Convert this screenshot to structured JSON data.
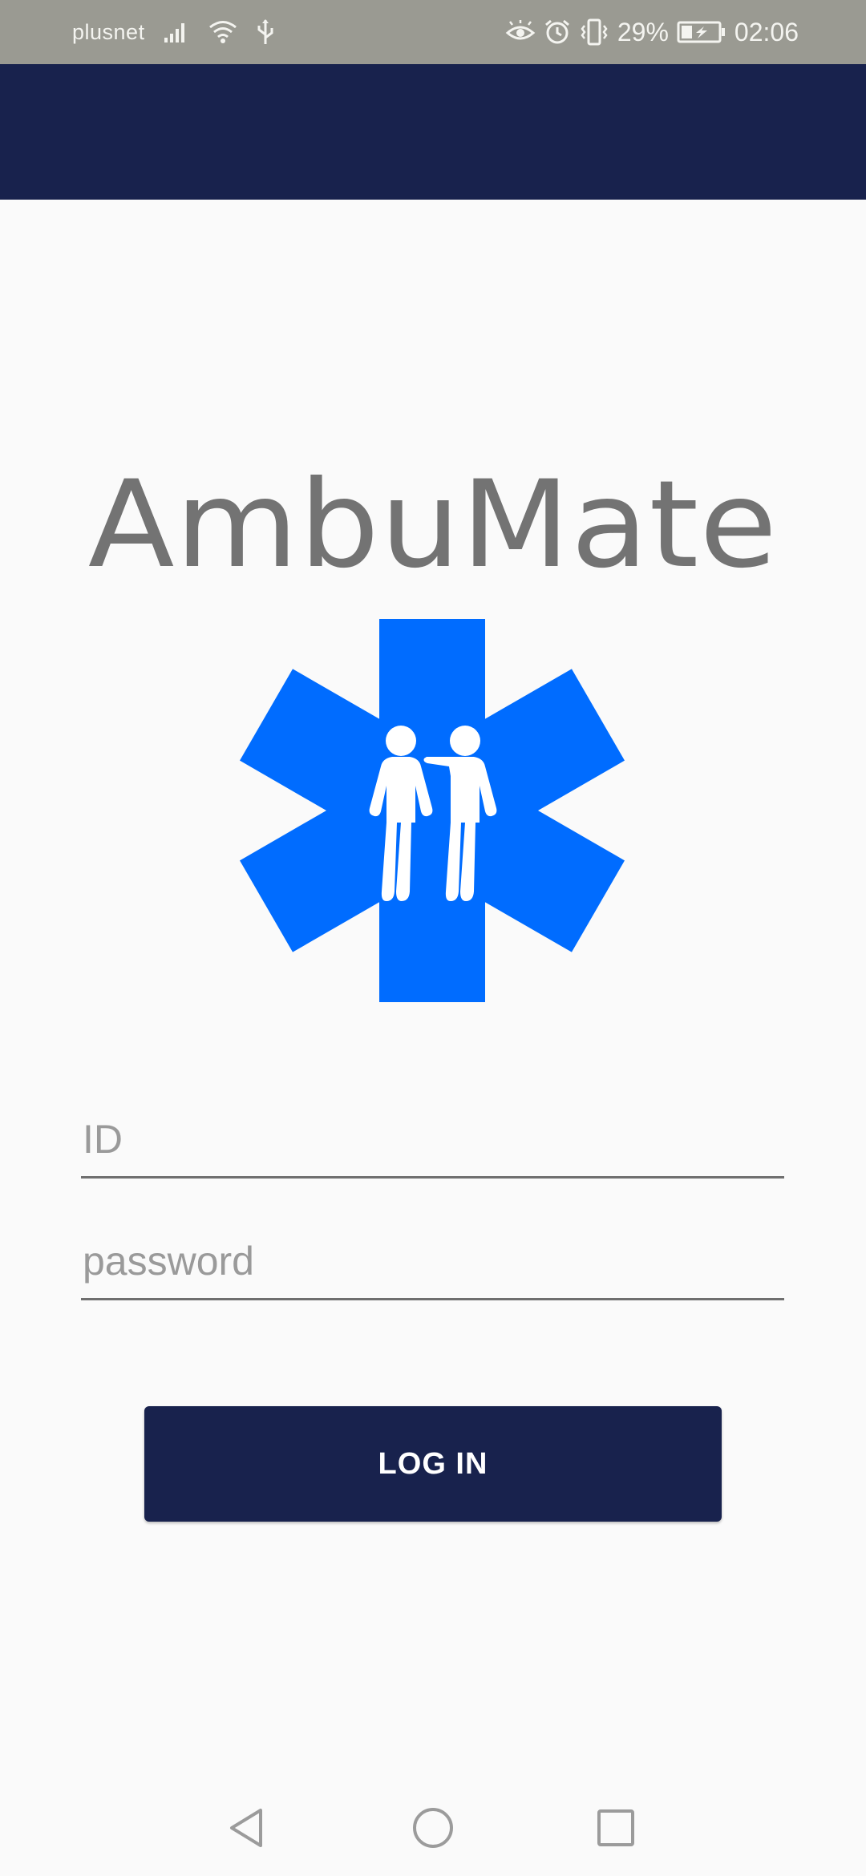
{
  "status_bar": {
    "carrier": "plusnet",
    "battery_percent": "29%",
    "time": "02:06",
    "left_icons": [
      "signal-icon",
      "wifi-icon",
      "usb-icon"
    ],
    "right_icons": [
      "eye-icon",
      "alarm-icon",
      "vibrate-icon",
      "battery-charging-icon"
    ]
  },
  "colors": {
    "status_bar_bg": "#9a9a92",
    "app_bar_bg": "#18224d",
    "accent_blue": "#006cff",
    "title_gray": "#737373",
    "background": "#fafafa"
  },
  "app": {
    "title": "AmbuMate",
    "logo_icon": "star-of-life-two-people-icon"
  },
  "form": {
    "id_placeholder": "ID",
    "password_placeholder": "password",
    "login_label": "LOG IN"
  },
  "nav_bar": {
    "icons": [
      "back-icon",
      "home-icon",
      "recents-icon"
    ]
  }
}
